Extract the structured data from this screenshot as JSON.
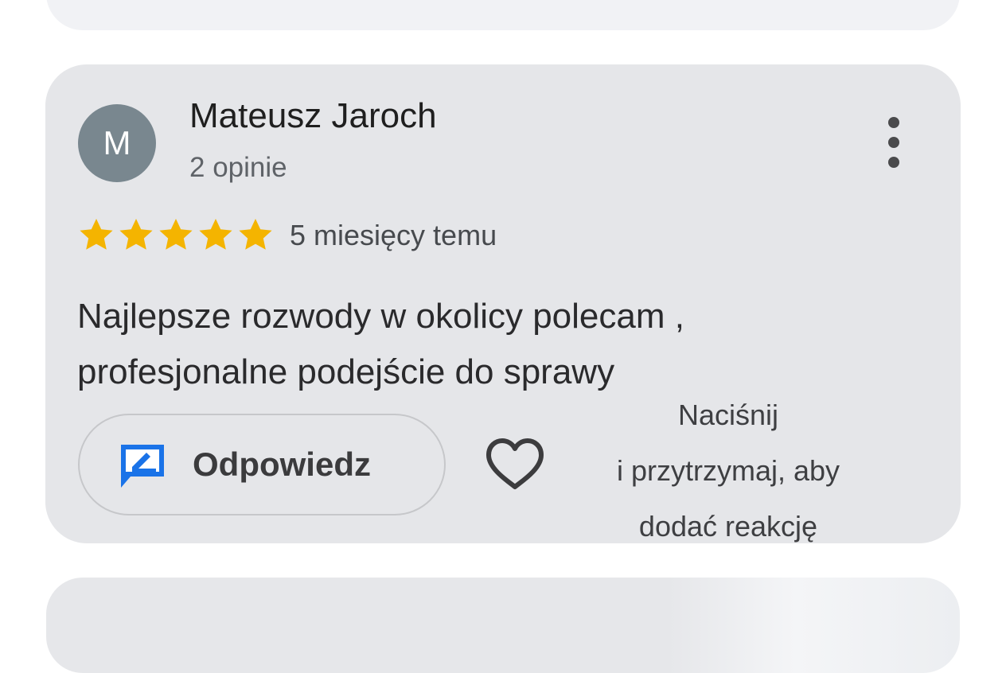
{
  "review": {
    "avatar_letter": "M",
    "author_name": "Mateusz Jaroch",
    "author_reviews": "2 opinie",
    "rating": 5,
    "rating_max": 5,
    "star_color": "#f4b400",
    "time_ago": "5 miesięcy temu",
    "text_line1": "Najlepsze rozwody w okolicy polecam ,",
    "text_line2": "profesjonalne podejście do sprawy",
    "reply_label": "Odpowiedz",
    "reply_icon": "reply-comment-icon",
    "reaction_icon": "heart-icon",
    "menu_icon": "more-vert-icon",
    "hint_line1": "Naciśnij",
    "hint_line2": "i przytrzymaj, aby",
    "hint_line3": "dodać reakcję"
  },
  "colors": {
    "card_background": "#e5e6e9",
    "avatar_background": "#79878f",
    "reply_icon_color": "#1a73e8"
  }
}
